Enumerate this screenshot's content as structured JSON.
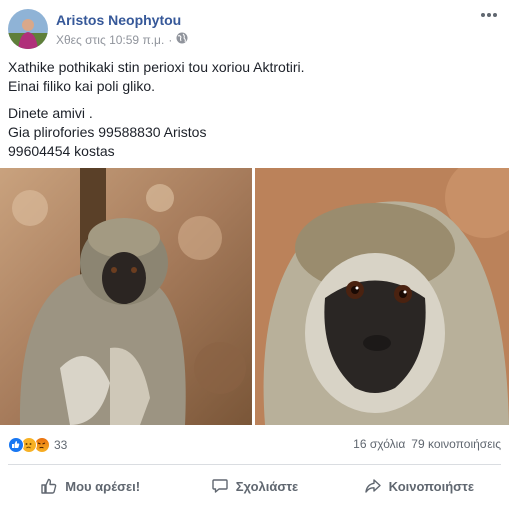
{
  "post": {
    "author": "Aristos Neophytou",
    "timestamp": "Χθες στις 10:59 π.μ.",
    "privacy_icon": "globe-icon",
    "more_icon": "more-options-icon",
    "text": {
      "line1": "Xathike pothikaki stin perioxi tou xoriou Aktrotiri.",
      "line2": "Einai filiko kai poli gliko.",
      "line3": "Dinete amivi .",
      "line4": "Gia plirofories 99588830 Aristos",
      "line5": "99604454 kostas"
    }
  },
  "engagement": {
    "reaction_count": "33",
    "reaction_icons": [
      "like-reaction-icon",
      "sad-reaction-icon",
      "angry-reaction-icon"
    ],
    "comments": "16 σχόλια",
    "shares": "79 κοινοποιήσεις"
  },
  "actions": {
    "like": "Μου αρέσει!",
    "comment": "Σχολιάστε",
    "share": "Κοινοποιήστε"
  },
  "colors": {
    "author_link": "#365899",
    "secondary_text": "#90949c",
    "like_blue": "#1877f2"
  }
}
